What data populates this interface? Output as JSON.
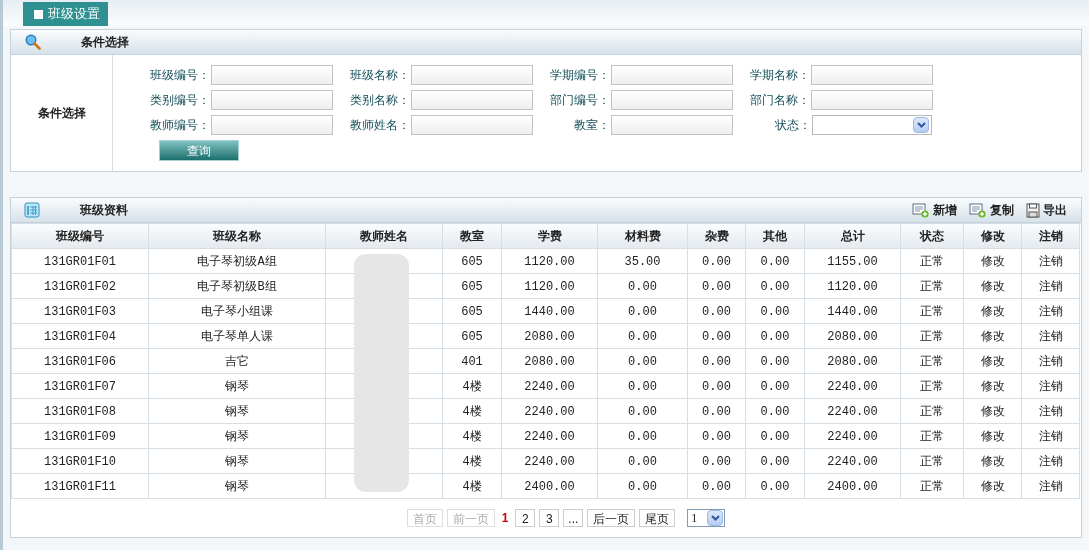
{
  "tab": {
    "label": "班级设置",
    "selected": true
  },
  "filter_panel": {
    "title": "条件选择",
    "side_label": "条件选择",
    "fields": [
      {
        "label": "班级编号：",
        "kind": "text"
      },
      {
        "label": "班级名称：",
        "kind": "text"
      },
      {
        "label": "学期编号：",
        "kind": "text"
      },
      {
        "label": "学期名称：",
        "kind": "text"
      },
      {
        "label": "类别编号：",
        "kind": "text"
      },
      {
        "label": "类别名称：",
        "kind": "text"
      },
      {
        "label": "部门编号：",
        "kind": "text"
      },
      {
        "label": "部门名称：",
        "kind": "text"
      },
      {
        "label": "教师编号：",
        "kind": "text"
      },
      {
        "label": "教师姓名：",
        "kind": "text"
      },
      {
        "label": "教室：",
        "kind": "text"
      },
      {
        "label": "状态：",
        "kind": "select"
      }
    ],
    "search_button": "查询"
  },
  "data_panel": {
    "title": "班级资料",
    "actions": [
      {
        "label": "新增",
        "kind": "add"
      },
      {
        "label": "复制",
        "kind": "copy"
      },
      {
        "label": "导出",
        "kind": "export"
      }
    ],
    "columns": [
      "班级编号",
      "班级名称",
      "教师姓名",
      "教室",
      "学费",
      "材料费",
      "杂费",
      "其他",
      "总计",
      "状态",
      "修改",
      "注销"
    ],
    "rows": [
      {
        "id": "131GR01F01",
        "name": "电子琴初级A组",
        "room": "605",
        "tuition": "1120.00",
        "material": "35.00",
        "misc": "0.00",
        "other": "0.00",
        "total": "1155.00",
        "status": "正常",
        "edit": "修改",
        "cancel": "注销"
      },
      {
        "id": "131GR01F02",
        "name": "电子琴初级B组",
        "room": "605",
        "tuition": "1120.00",
        "material": "0.00",
        "misc": "0.00",
        "other": "0.00",
        "total": "1120.00",
        "status": "正常",
        "edit": "修改",
        "cancel": "注销"
      },
      {
        "id": "131GR01F03",
        "name": "电子琴小组课",
        "room": "605",
        "tuition": "1440.00",
        "material": "0.00",
        "misc": "0.00",
        "other": "0.00",
        "total": "1440.00",
        "status": "正常",
        "edit": "修改",
        "cancel": "注销"
      },
      {
        "id": "131GR01F04",
        "name": "电子琴单人课",
        "room": "605",
        "tuition": "2080.00",
        "material": "0.00",
        "misc": "0.00",
        "other": "0.00",
        "total": "2080.00",
        "status": "正常",
        "edit": "修改",
        "cancel": "注销"
      },
      {
        "id": "131GR01F06",
        "name": "吉它",
        "room": "401",
        "tuition": "2080.00",
        "material": "0.00",
        "misc": "0.00",
        "other": "0.00",
        "total": "2080.00",
        "status": "正常",
        "edit": "修改",
        "cancel": "注销"
      },
      {
        "id": "131GR01F07",
        "name": "钢琴",
        "room": "4楼",
        "tuition": "2240.00",
        "material": "0.00",
        "misc": "0.00",
        "other": "0.00",
        "total": "2240.00",
        "status": "正常",
        "edit": "修改",
        "cancel": "注销"
      },
      {
        "id": "131GR01F08",
        "name": "钢琴",
        "room": "4楼",
        "tuition": "2240.00",
        "material": "0.00",
        "misc": "0.00",
        "other": "0.00",
        "total": "2240.00",
        "status": "正常",
        "edit": "修改",
        "cancel": "注销"
      },
      {
        "id": "131GR01F09",
        "name": "钢琴",
        "room": "4楼",
        "tuition": "2240.00",
        "material": "0.00",
        "misc": "0.00",
        "other": "0.00",
        "total": "2240.00",
        "status": "正常",
        "edit": "修改",
        "cancel": "注销"
      },
      {
        "id": "131GR01F10",
        "name": "钢琴",
        "room": "4楼",
        "tuition": "2240.00",
        "material": "0.00",
        "misc": "0.00",
        "other": "0.00",
        "total": "2240.00",
        "status": "正常",
        "edit": "修改",
        "cancel": "注销"
      },
      {
        "id": "131GR01F11",
        "name": "钢琴",
        "room": "4楼",
        "tuition": "2400.00",
        "material": "0.00",
        "misc": "0.00",
        "other": "0.00",
        "total": "2400.00",
        "status": "正常",
        "edit": "修改",
        "cancel": "注销"
      }
    ]
  },
  "pagination": {
    "items": [
      {
        "label": "首页",
        "kind": "nav",
        "disabled": true
      },
      {
        "label": "前一页",
        "kind": "nav",
        "disabled": true
      },
      {
        "label": "1",
        "kind": "page",
        "selected": true
      },
      {
        "label": "2",
        "kind": "page",
        "selected": false
      },
      {
        "label": "3",
        "kind": "page",
        "selected": false
      },
      {
        "label": "...",
        "kind": "page",
        "selected": false
      },
      {
        "label": "后一页",
        "kind": "nav",
        "disabled": false
      },
      {
        "label": "尾页",
        "kind": "nav",
        "disabled": false
      }
    ],
    "page_select": "1"
  }
}
